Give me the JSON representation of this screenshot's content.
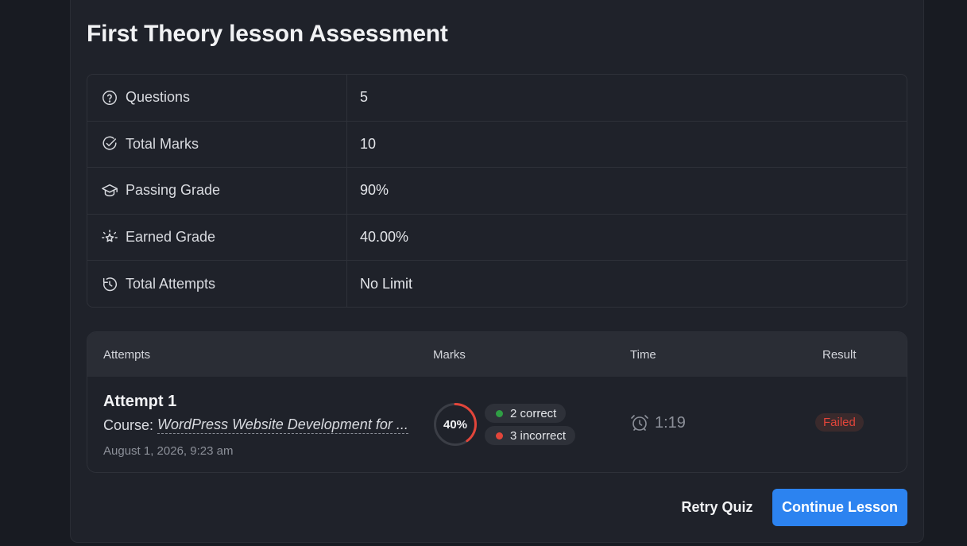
{
  "page": {
    "title": "First Theory lesson Assessment"
  },
  "info": [
    {
      "icon": "question-circle-icon",
      "label": "Questions",
      "value": "5"
    },
    {
      "icon": "check-circle-icon",
      "label": "Total Marks",
      "value": "10"
    },
    {
      "icon": "graduation-cap-icon",
      "label": "Passing Grade",
      "value": "90%"
    },
    {
      "icon": "sparkle-star-icon",
      "label": "Earned Grade",
      "value": "40.00%"
    },
    {
      "icon": "rotate-attempts-icon",
      "label": "Total Attempts",
      "value": "No Limit"
    }
  ],
  "attempts": {
    "headers": {
      "attempts": "Attempts",
      "marks": "Marks",
      "time": "Time",
      "result": "Result"
    },
    "rows": [
      {
        "name": "Attempt 1",
        "course_prefix": "Course:",
        "course_name": "WordPress Website Development for ...",
        "date": "August 1, 2026, 9:23 am",
        "score_text": "40%",
        "score_fraction": 0.4,
        "correct": "2 correct",
        "incorrect": "3 incorrect",
        "time": "1:19",
        "result": "Failed"
      }
    ]
  },
  "colors": {
    "accent": "#2c83f0",
    "correct": "#2f9e44",
    "incorrect": "#e2453a"
  },
  "actions": {
    "retry": "Retry Quiz",
    "continue": "Continue Lesson"
  }
}
